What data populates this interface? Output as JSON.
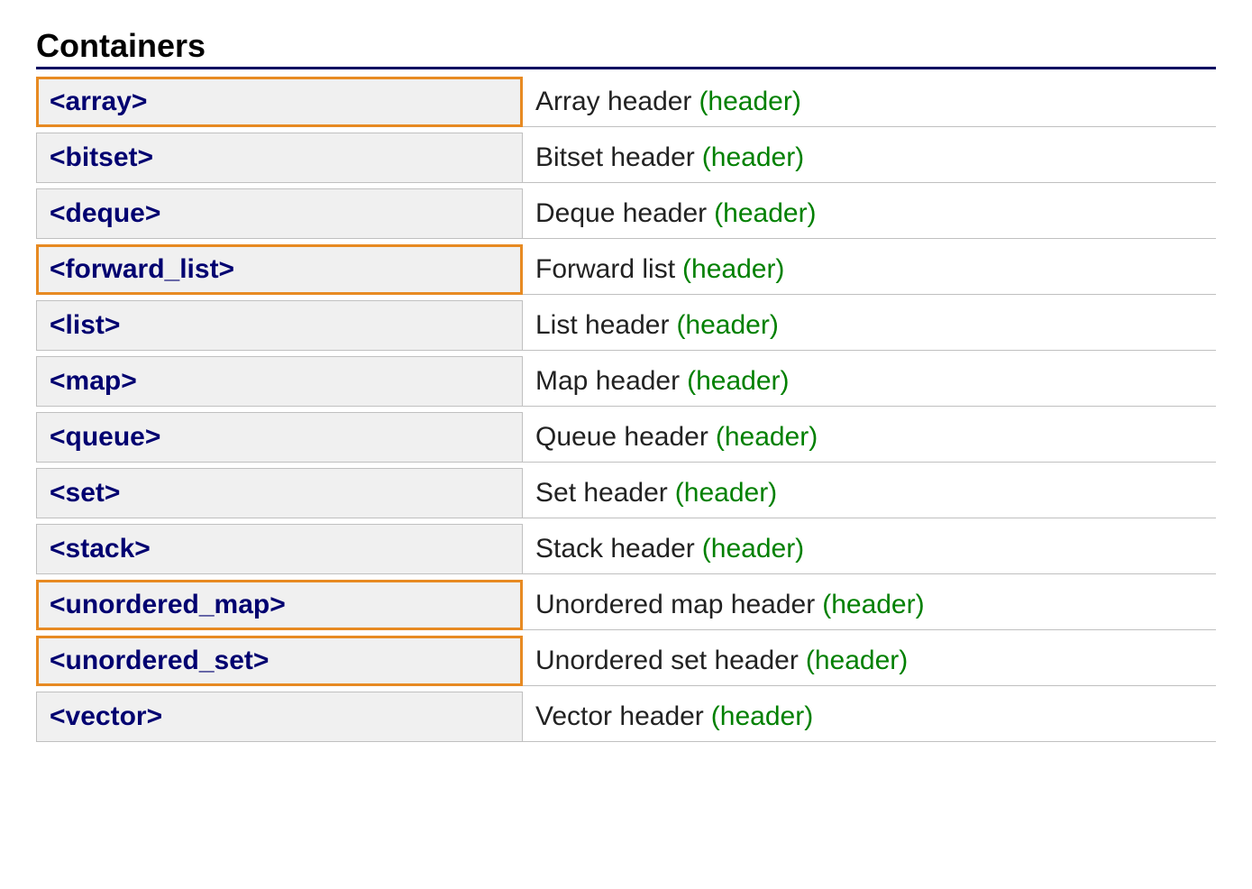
{
  "section_title": "Containers",
  "tag_label": "(header)",
  "rows": [
    {
      "name": "<array>",
      "desc": "Array header",
      "highlight": true
    },
    {
      "name": "<bitset>",
      "desc": "Bitset header",
      "highlight": false
    },
    {
      "name": "<deque>",
      "desc": "Deque header",
      "highlight": false
    },
    {
      "name": "<forward_list>",
      "desc": "Forward list",
      "highlight": true
    },
    {
      "name": "<list>",
      "desc": "List header",
      "highlight": false
    },
    {
      "name": "<map>",
      "desc": "Map header",
      "highlight": false
    },
    {
      "name": "<queue>",
      "desc": "Queue header",
      "highlight": false
    },
    {
      "name": "<set>",
      "desc": "Set header",
      "highlight": false
    },
    {
      "name": "<stack>",
      "desc": "Stack header",
      "highlight": false
    },
    {
      "name": "<unordered_map>",
      "desc": "Unordered map header",
      "highlight": true
    },
    {
      "name": "<unordered_set>",
      "desc": "Unordered set header",
      "highlight": true
    },
    {
      "name": "<vector>",
      "desc": "Vector header",
      "highlight": false
    }
  ]
}
